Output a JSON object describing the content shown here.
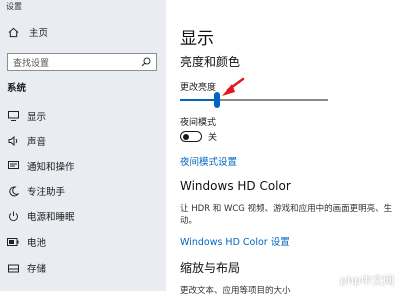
{
  "window": {
    "title": "设置"
  },
  "sidebar": {
    "home_label": "主页",
    "search_placeholder": "查找设置",
    "section_title": "系统",
    "items": [
      {
        "label": "显示",
        "icon": "monitor-icon"
      },
      {
        "label": "声音",
        "icon": "speaker-icon"
      },
      {
        "label": "通知和操作",
        "icon": "notification-icon"
      },
      {
        "label": "专注助手",
        "icon": "moon-icon"
      },
      {
        "label": "电源和睡眠",
        "icon": "power-icon"
      },
      {
        "label": "电池",
        "icon": "battery-icon"
      },
      {
        "label": "存储",
        "icon": "storage-icon"
      }
    ]
  },
  "main": {
    "title": "显示",
    "brightness_section": "亮度和颜色",
    "brightness_label": "更改亮度",
    "brightness_level": 0.25,
    "night_mode_label": "夜间模式",
    "night_mode_state": "关",
    "night_mode_link": "夜间模式设置",
    "hd_title": "Windows HD Color",
    "hd_desc": "让 HDR 和 WCG 视频、游戏和应用中的画面更明亮、生动。",
    "hd_link": "Windows HD Color 设置",
    "scale_section": "缩放与布局",
    "scale_partial": "更改文本、应用等项目的大小"
  },
  "watermark": "php中文网",
  "colors": {
    "accent": "#0067c0",
    "annotation_arrow": "#e0191e",
    "sidebar_bg": "#e9edf2"
  }
}
